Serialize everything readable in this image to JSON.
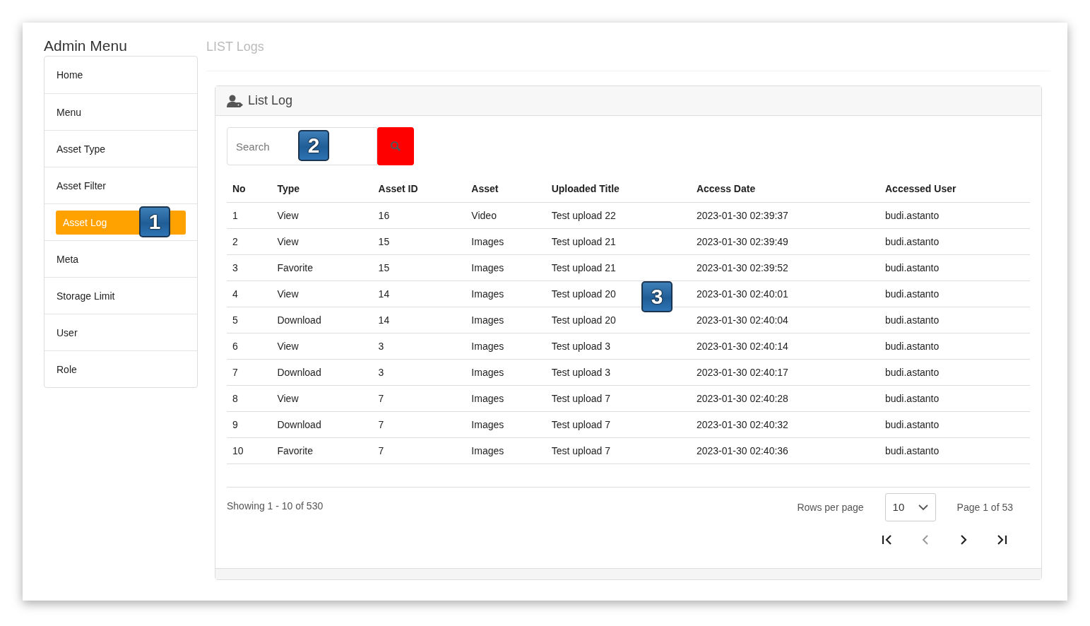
{
  "sidebar": {
    "title": "Admin Menu",
    "callout": "1",
    "items": [
      {
        "label": "Home",
        "selected": false
      },
      {
        "label": "Menu",
        "selected": false
      },
      {
        "label": "Asset Type",
        "selected": false
      },
      {
        "label": "Asset Filter",
        "selected": false
      },
      {
        "label": "Asset Log",
        "selected": true
      },
      {
        "label": "Meta",
        "selected": false
      },
      {
        "label": "Storage Limit",
        "selected": false
      },
      {
        "label": "User",
        "selected": false
      },
      {
        "label": "Role",
        "selected": false
      }
    ]
  },
  "page_title": "LIST Logs",
  "card": {
    "title": "List Log",
    "search": {
      "placeholder": "Search",
      "callout": "2"
    },
    "table": {
      "callout": "3",
      "columns": [
        "No",
        "Type",
        "Asset ID",
        "Asset",
        "Uploaded Title",
        "Access Date",
        "Accessed User"
      ],
      "rows": [
        [
          "1",
          "View",
          "16",
          "Video",
          "Test upload 22",
          "2023-01-30 02:39:37",
          "budi.astanto"
        ],
        [
          "2",
          "View",
          "15",
          "Images",
          "Test upload 21",
          "2023-01-30 02:39:49",
          "budi.astanto"
        ],
        [
          "3",
          "Favorite",
          "15",
          "Images",
          "Test upload 21",
          "2023-01-30 02:39:52",
          "budi.astanto"
        ],
        [
          "4",
          "View",
          "14",
          "Images",
          "Test upload 20",
          "2023-01-30 02:40:01",
          "budi.astanto"
        ],
        [
          "5",
          "Download",
          "14",
          "Images",
          "Test upload 20",
          "2023-01-30 02:40:04",
          "budi.astanto"
        ],
        [
          "6",
          "View",
          "3",
          "Images",
          "Test upload 3",
          "2023-01-30 02:40:14",
          "budi.astanto"
        ],
        [
          "7",
          "Download",
          "3",
          "Images",
          "Test upload 3",
          "2023-01-30 02:40:17",
          "budi.astanto"
        ],
        [
          "8",
          "View",
          "7",
          "Images",
          "Test upload 7",
          "2023-01-30 02:40:28",
          "budi.astanto"
        ],
        [
          "9",
          "Download",
          "7",
          "Images",
          "Test upload 7",
          "2023-01-30 02:40:32",
          "budi.astanto"
        ],
        [
          "10",
          "Favorite",
          "7",
          "Images",
          "Test upload 7",
          "2023-01-30 02:40:36",
          "budi.astanto"
        ]
      ]
    },
    "footer": {
      "showing": "Showing 1 - 10 of 530",
      "rows_per_page_label": "Rows per page",
      "rows_per_page": "10",
      "page": "Page 1 of 53",
      "nav": [
        {
          "kind": "first",
          "disabled": false
        },
        {
          "kind": "prev",
          "disabled": true
        },
        {
          "kind": "next",
          "disabled": false
        },
        {
          "kind": "last",
          "disabled": false
        }
      ]
    }
  }
}
